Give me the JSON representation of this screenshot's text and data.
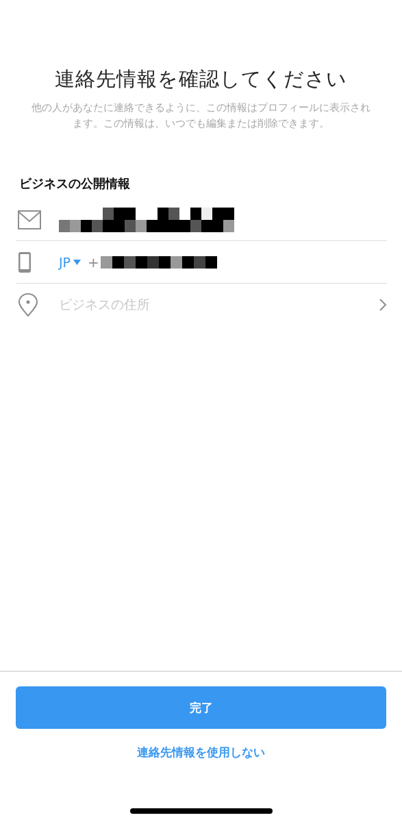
{
  "title": "連絡先情報を確認してください",
  "description": "他の人があなたに連絡できるように、この情報はプロフィールに表示されます。この情報は、いつでも編集または削除できます。",
  "section": {
    "heading": "ビジネスの公開情報",
    "rows": [
      {
        "kind": "email"
      },
      {
        "kind": "phone",
        "country": "JP",
        "prefix": "+"
      },
      {
        "kind": "address",
        "placeholder": "ビジネスの住所"
      }
    ]
  },
  "primary_button": "完了",
  "secondary_link": "連絡先情報を使用しない"
}
